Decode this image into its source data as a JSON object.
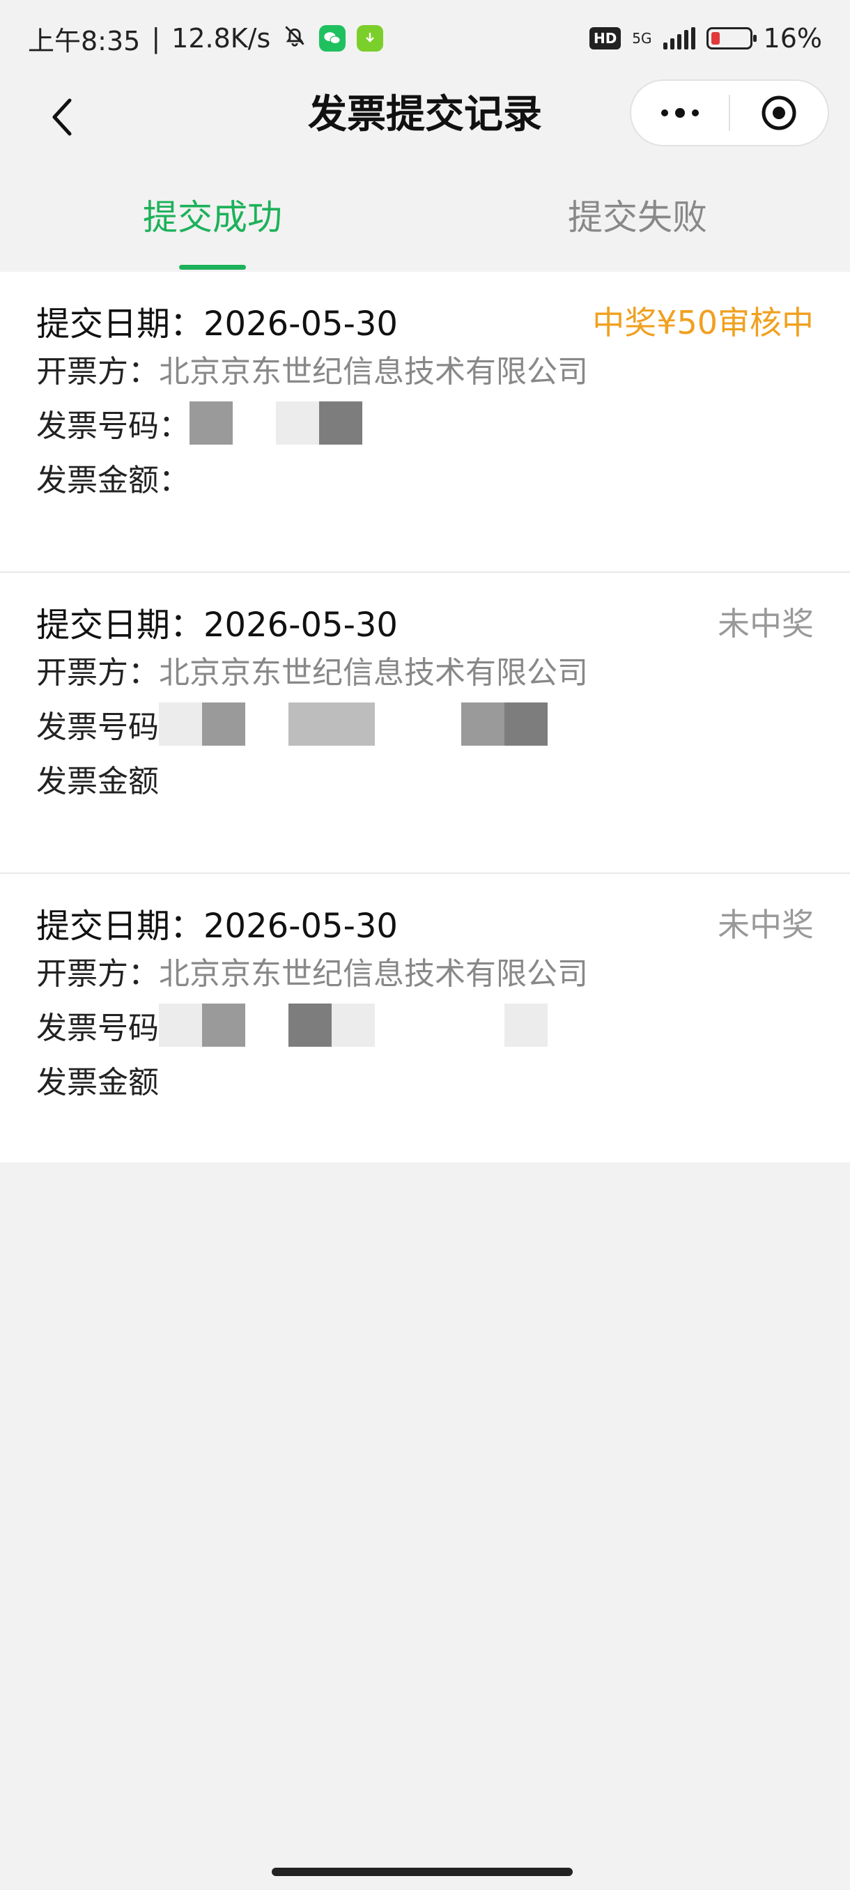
{
  "status_bar": {
    "time": "上午8:35",
    "speed": "12.8K/s",
    "hd": "HD",
    "network": "5G",
    "battery": "16%"
  },
  "header": {
    "title": "发票提交记录"
  },
  "tabs": [
    {
      "label": "提交成功",
      "active": true
    },
    {
      "label": "提交失败",
      "active": false
    }
  ],
  "records": [
    {
      "date_label": "提交日期：",
      "date": "2026-05-30",
      "status": "中奖¥50审核中",
      "issuer_label": "开票方：",
      "issuer": "北京京东世纪信息技术有限公司",
      "number_label": "发票号码：",
      "amount_label": "发票金额："
    },
    {
      "date_label": "提交日期：",
      "date": "2026-05-30",
      "status": "未中奖",
      "issuer_label": "开票方：",
      "issuer": "北京京东世纪信息技术有限公司",
      "number_label": "发票号码",
      "amount_label": "发票金额"
    },
    {
      "date_label": "提交日期：",
      "date": "2026-05-30",
      "status": "未中奖",
      "issuer_label": "开票方：",
      "issuer": "北京京东世纪信息技术有限公司",
      "number_label": "发票号码",
      "amount_label": "发票金额"
    }
  ],
  "colors": {
    "accent_green": "#1db15a",
    "prize_orange": "#f0a020"
  }
}
